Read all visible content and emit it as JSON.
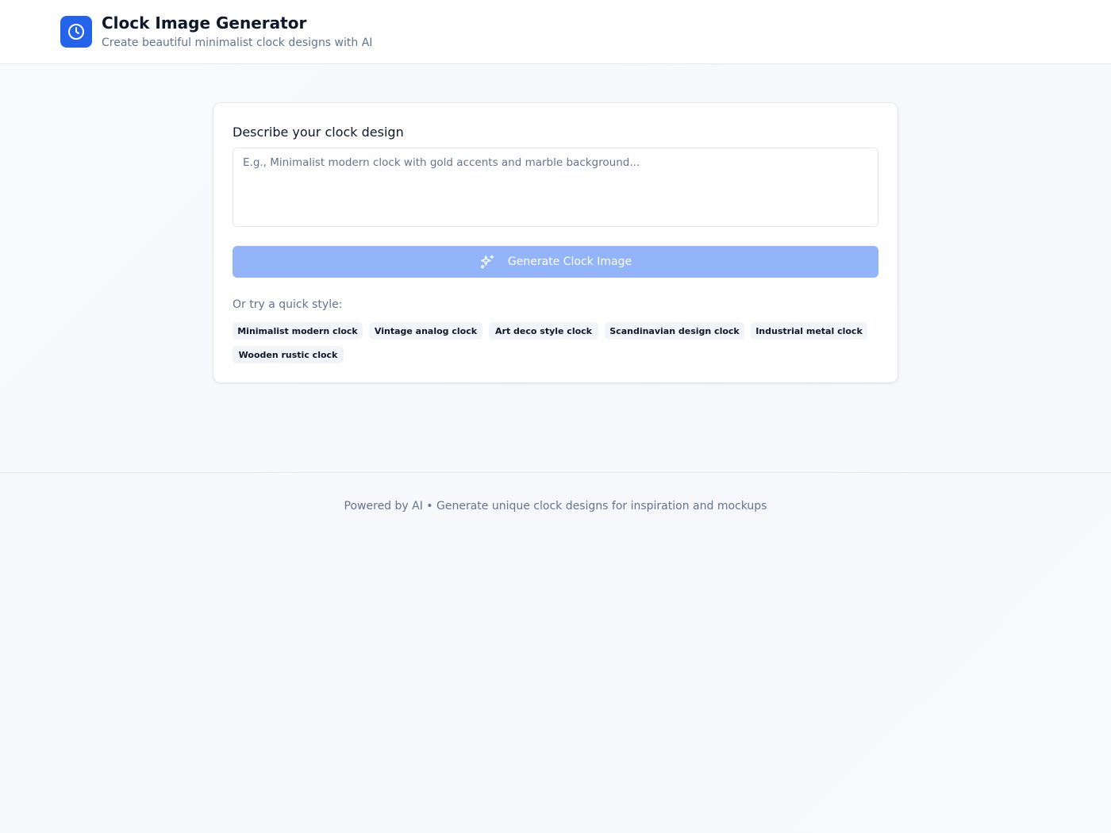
{
  "header": {
    "title": "Clock Image Generator",
    "subtitle": "Create beautiful minimalist clock designs with AI",
    "logo_icon": "clock-icon",
    "accent_color": "#2563eb"
  },
  "form": {
    "label": "Describe your clock design",
    "input_value": "",
    "input_placeholder": "E.g., Minimalist modern clock with gold accents and marble background...",
    "generate_label": "Generate Clock Image",
    "generate_icon": "sparkles-icon",
    "generate_color": "#93b4f8",
    "quick_label": "Or try a quick style:",
    "quick_styles": [
      "Minimalist modern clock",
      "Vintage analog clock",
      "Art deco style clock",
      "Scandinavian design clock",
      "Industrial metal clock",
      "Wooden rustic clock"
    ]
  },
  "footer": {
    "text": "Powered by AI • Generate unique clock designs for inspiration and mockups"
  }
}
